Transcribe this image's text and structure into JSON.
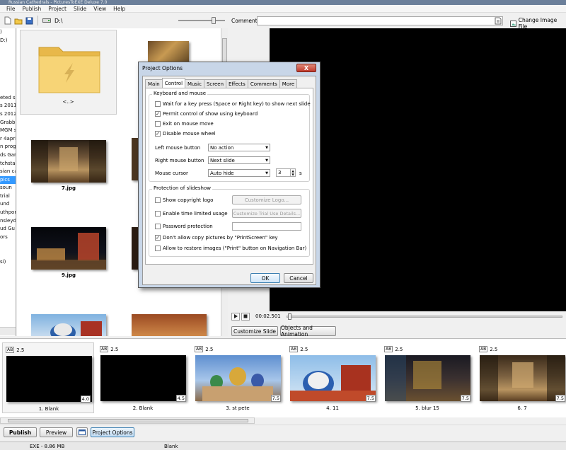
{
  "app": {
    "title_fragment": "Russian Cathedrals - PicturesToEXE Deluxe 7.0"
  },
  "menu": [
    "File",
    "Publish",
    "Project",
    "Slide",
    "View",
    "Help"
  ],
  "toolbar": {
    "path": "D:\\"
  },
  "comment": {
    "label": "Comment",
    "change_image": "Change Image File"
  },
  "tree": {
    "items": [
      ")",
      "D:)",
      "",
      "",
      "",
      "",
      "",
      "",
      "eted sl",
      "s 2011",
      "s 2012",
      "Grabb",
      "MGM s",
      "r 4april",
      "n prog",
      "ds Gar",
      "tchsta",
      "sian ca",
      "pics",
      "soun",
      "trial",
      "und",
      "uthpor",
      "nsleyd",
      "ud Gu",
      "ors",
      "",
      "",
      "si)"
    ],
    "selected_index": 18
  },
  "files": {
    "folder_label": "<..>",
    "labels": [
      "7.jpg",
      "9.jpg"
    ]
  },
  "player": {
    "time": "00:02.501"
  },
  "buttons": {
    "customize_slide": "Customize Slide",
    "objects_animation": "Objects and Animation",
    "publish": "Publish",
    "preview": "Preview",
    "project_options": "Project Options"
  },
  "slides": [
    {
      "ab": "AB",
      "transition": "2.5",
      "duration": "4.0",
      "name": "1. Blank"
    },
    {
      "ab": "AB",
      "transition": "2.5",
      "duration": "4.5",
      "name": "2. Blank"
    },
    {
      "ab": "AB",
      "transition": "2.5",
      "duration": "7.5",
      "name": "3. st pete"
    },
    {
      "ab": "AB",
      "transition": "2.5",
      "duration": "7.5",
      "name": "4. 11"
    },
    {
      "ab": "AB",
      "transition": "2.5",
      "duration": "7.5",
      "name": "5. blur 15"
    },
    {
      "ab": "AB",
      "transition": "2.5",
      "duration": "7.5",
      "name": "6. 7"
    }
  ],
  "status": {
    "exe": "EXE - 8.86 MB",
    "slide": "Blank"
  },
  "dialog": {
    "title": "Project Options",
    "close": "X",
    "tabs": [
      "Main",
      "Control",
      "Music",
      "Screen",
      "Effects",
      "Comments",
      "More"
    ],
    "active_tab": 1,
    "keyboard_group": "Keyboard and mouse",
    "checks": [
      {
        "label": "Wait for a key press (Space or Right key) to show next slide",
        "checked": false
      },
      {
        "label": "Permit control of show using keyboard",
        "checked": true
      },
      {
        "label": "Exit on mouse move",
        "checked": false
      },
      {
        "label": "Disable mouse wheel",
        "checked": true
      }
    ],
    "left_mouse": {
      "label": "Left mouse button",
      "value": "No action"
    },
    "right_mouse": {
      "label": "Right mouse button",
      "value": "Next slide"
    },
    "cursor": {
      "label": "Mouse cursor",
      "value": "Auto hide",
      "seconds": "3",
      "unit": "s"
    },
    "protection_group": "Protection of slideshow",
    "protection": [
      {
        "label": "Show copyright logo",
        "checked": false,
        "button": "Customize Logo..."
      },
      {
        "label": "Enable time limited usage",
        "checked": false,
        "button": "Customize Trial Use Details..."
      },
      {
        "label": "Password protection",
        "checked": false
      },
      {
        "label": "Don't allow copy pictures by \"PrintScreen\" key",
        "checked": true
      },
      {
        "label": "Allow to restore images (\"Print\" button on Navigation Bar)",
        "checked": false
      }
    ],
    "ok": "OK",
    "cancel": "Cancel"
  }
}
